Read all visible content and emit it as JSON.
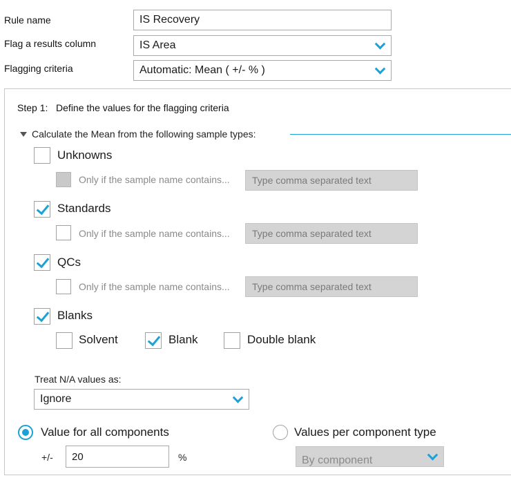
{
  "rule_name": {
    "label": "Rule name",
    "value": "IS Recovery"
  },
  "flag_column": {
    "label": "Flag a results column",
    "value": "IS Area"
  },
  "flag_criteria": {
    "label": "Flagging criteria",
    "value": "Automatic: Mean ( +/- % )"
  },
  "step1": {
    "heading": "Step 1:   Define the values for the flagging criteria",
    "section_label": "Calculate the Mean from the following sample types:",
    "sample_types": [
      {
        "label": "Unknowns",
        "checked": false,
        "sub_label": "Only if the sample name contains...",
        "sub_placeholder": "Type comma separated text"
      },
      {
        "label": "Standards",
        "checked": true,
        "sub_label": "Only if the sample name contains...",
        "sub_placeholder": "Type comma separated text"
      },
      {
        "label": "QCs",
        "checked": true,
        "sub_label": "Only if the sample name contains...",
        "sub_placeholder": "Type comma separated text"
      },
      {
        "label": "Blanks",
        "checked": true
      }
    ],
    "blank_types": [
      {
        "label": "Solvent",
        "checked": false
      },
      {
        "label": "Blank",
        "checked": true
      },
      {
        "label": "Double blank",
        "checked": false
      }
    ],
    "treat_na": {
      "label": "Treat N/A values as:",
      "value": "Ignore"
    },
    "value_mode": {
      "all_components": {
        "label": "Value for all components",
        "selected": true
      },
      "per_type": {
        "label": "Values per component type",
        "selected": false
      },
      "plusminus_label": "+/-",
      "value": "20",
      "unit": "%",
      "per_type_dropdown": "By component"
    }
  },
  "colors": {
    "accent": "#1ba1d6"
  }
}
